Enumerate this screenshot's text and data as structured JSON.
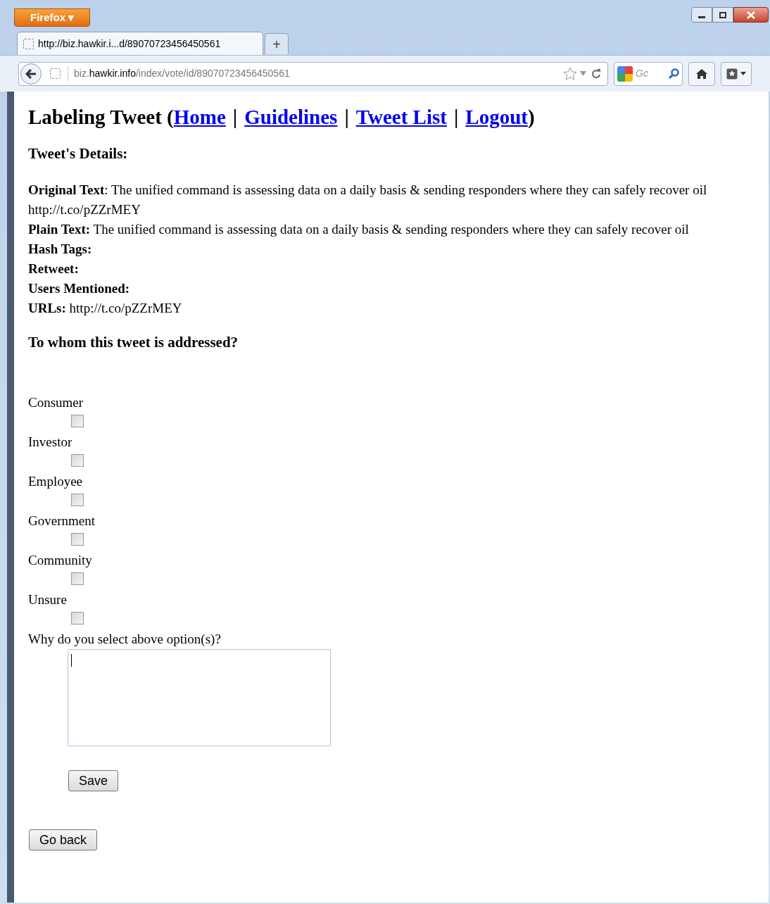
{
  "browser": {
    "menu_button": "Firefox ▾",
    "tab": {
      "title": "http://biz.hawkir.i...d/89070723456450561",
      "selected": true
    },
    "new_tab": "+",
    "url": {
      "subdomain": "biz.",
      "domain": "hawkir.info",
      "path": "/index/vote/id/89070723456450561"
    },
    "search": {
      "placeholder": "Gc"
    }
  },
  "heading": {
    "prefix": "Labeling Tweet (",
    "links": [
      "Home",
      "Guidelines",
      "Tweet List",
      "Logout"
    ],
    "separators": [
      "|",
      "|",
      "|"
    ],
    "suffix": ")"
  },
  "details_title": "Tweet's Details:",
  "details": [
    "**Original Text**: The unified command is assessing data on a daily basis & sending responders where they can safely recover oil http://t.co/pZZrMEY",
    "**Plain Text:** The unified command is assessing data on a daily basis & sending responders where they can safely recover oil",
    "**Hash Tags:**",
    "**Retweet:**",
    "**Users Mentioned:**",
    "**URLs:** http://t.co/pZZrMEY"
  ],
  "question": "To whom this tweet is addressed?",
  "options": [
    {
      "label": "Consumer",
      "checked": false
    },
    {
      "label": "Investor",
      "checked": false
    },
    {
      "label": "Employee",
      "checked": false
    },
    {
      "label": "Government",
      "checked": false
    },
    {
      "label": "Community",
      "checked": false
    },
    {
      "label": "Unsure",
      "checked": false
    }
  ],
  "reason_label": "Why do you select above option(s)?",
  "save_button": "Save",
  "back_button": "Go back"
}
